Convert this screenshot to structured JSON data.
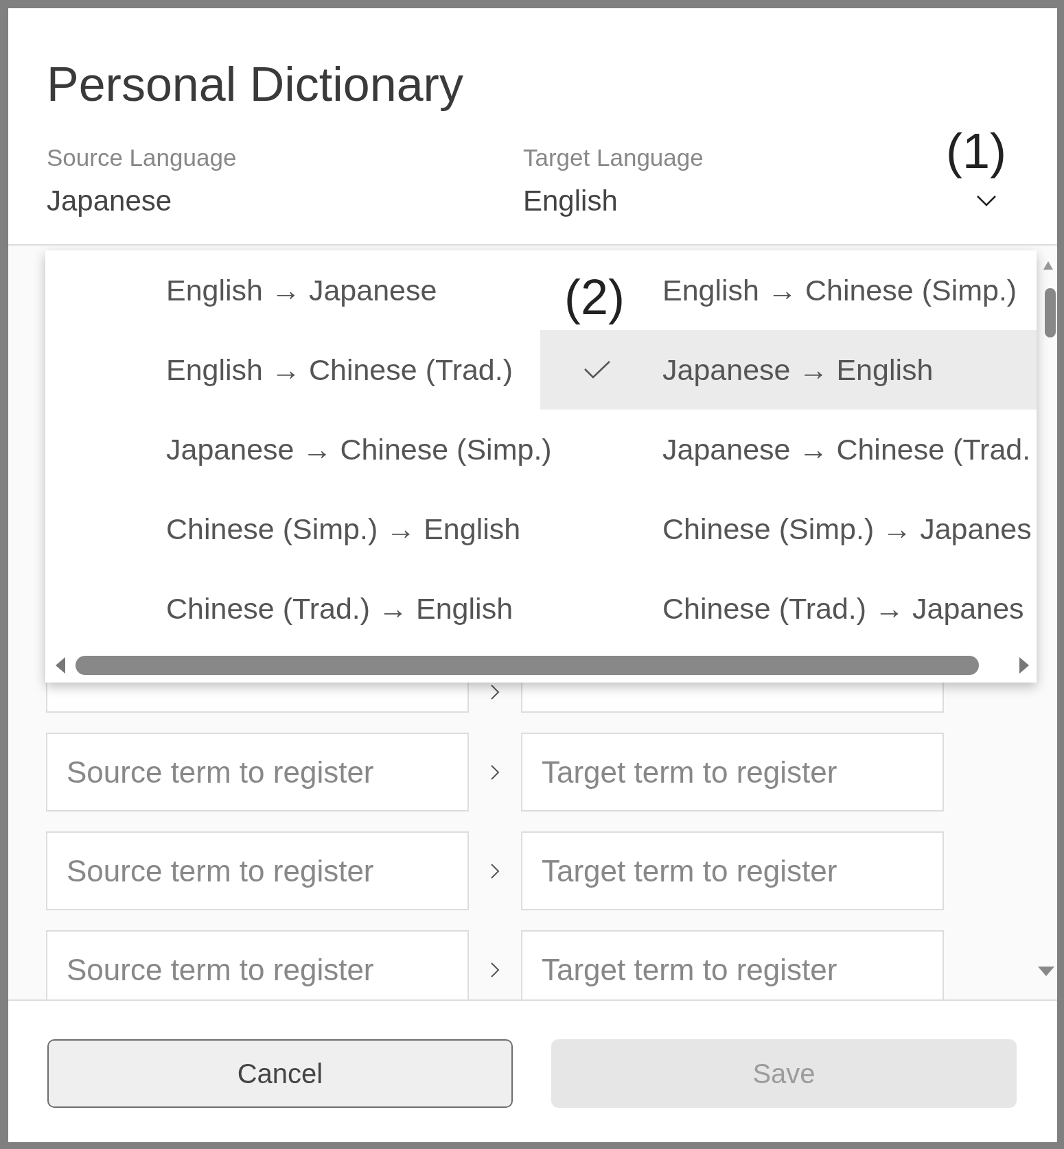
{
  "dialog": {
    "title": "Personal Dictionary"
  },
  "languages": {
    "source_label": "Source Language",
    "source_value": "Japanese",
    "target_label": "Target Language",
    "target_value": "English"
  },
  "annotations": [
    {
      "label": "(1)"
    },
    {
      "label": "(2)"
    }
  ],
  "language_pairs": [
    {
      "label": "English → Japanese",
      "selected": false
    },
    {
      "label": "English → Chinese (Simp.)",
      "selected": false
    },
    {
      "label": "English → Chinese (Trad.)",
      "selected": false
    },
    {
      "label": "Japanese → English",
      "selected": true
    },
    {
      "label": "Japanese → Chinese (Simp.)",
      "selected": false
    },
    {
      "label": "Japanese → Chinese (Trad.",
      "selected": false
    },
    {
      "label": "Chinese (Simp.) → English",
      "selected": false
    },
    {
      "label": "Chinese (Simp.) → Japanes",
      "selected": false
    },
    {
      "label": "Chinese (Trad.) → English",
      "selected": false
    },
    {
      "label": "Chinese (Trad.) → Japanes",
      "selected": false
    }
  ],
  "term_rows": [
    {
      "source_placeholder": "Source term to register",
      "target_placeholder": "Target term to register"
    },
    {
      "source_placeholder": "Source term to register",
      "target_placeholder": "Target term to register"
    },
    {
      "source_placeholder": "Source term to register",
      "target_placeholder": "Target term to register"
    }
  ],
  "buttons": [
    {
      "label": "Cancel",
      "disabled": false
    },
    {
      "label": "Save",
      "disabled": true
    }
  ]
}
